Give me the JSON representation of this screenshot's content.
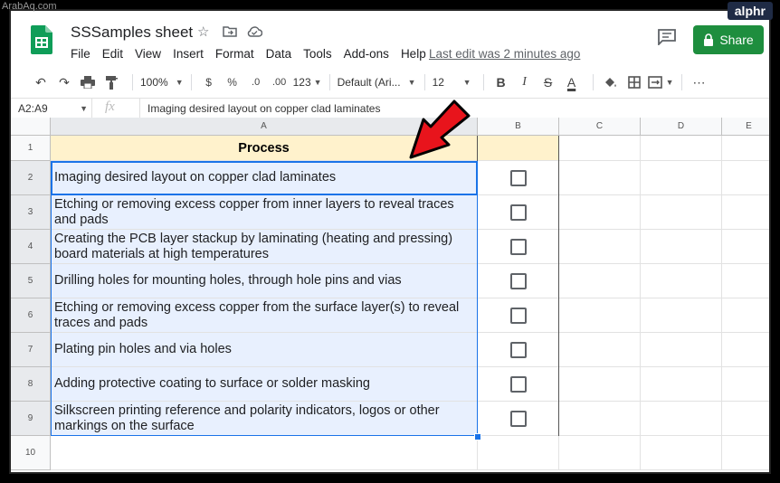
{
  "watermark": "ArabAq.com",
  "brand_badge": "alphr",
  "doc": {
    "title": "SSSamples sheet",
    "last_edit": "Last edit was 2 minutes ago",
    "share_label": "Share"
  },
  "menu": [
    "File",
    "Edit",
    "View",
    "Insert",
    "Format",
    "Data",
    "Tools",
    "Add-ons",
    "Help"
  ],
  "toolbar": {
    "zoom": "100%",
    "currency": "$",
    "percent": "%",
    "decrease_decimal": ".0",
    "increase_decimal": ".00",
    "more_formats": "123",
    "font": "Default (Ari...",
    "font_size": "12",
    "bold": "B",
    "italic": "I",
    "strike": "S",
    "text_color": "A",
    "more": "⋯"
  },
  "formula_bar": {
    "name_box": "A2:A9",
    "fx": "fx",
    "content": "Imaging desired layout on copper clad laminates"
  },
  "columns": [
    "A",
    "B",
    "C",
    "D",
    "E"
  ],
  "rows": [
    "1",
    "2",
    "3",
    "4",
    "5",
    "6",
    "7",
    "8",
    "9",
    "10"
  ],
  "header_cell": "Process",
  "process_items": [
    "Imaging desired layout on copper clad laminates",
    "Etching or removing excess copper from inner layers to reveal traces and pads",
    "Creating the PCB layer stackup by laminating (heating and pressing) board materials at high temperatures",
    "Drilling holes for mounting holes, through hole pins and vias",
    "Etching or removing excess copper from the surface layer(s) to reveal traces and pads",
    "Plating pin holes and via holes",
    "Adding protective coating to surface or solder masking",
    "Silkscreen printing reference and polarity indicators, logos or other markings on the surface"
  ],
  "checkboxes": [
    false,
    false,
    false,
    false,
    false,
    false,
    false,
    false
  ],
  "colors": {
    "accent": "#1a73e8",
    "share": "#1e8e3e",
    "header_fill": "#fff2cc",
    "selection_fill": "#e8f0fe",
    "annotation_arrow": "#e8141c"
  }
}
